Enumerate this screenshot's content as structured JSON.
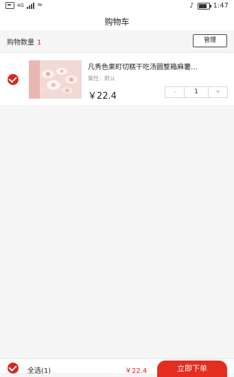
{
  "status_bar": {
    "time": "1:47",
    "network": "4G",
    "battery_level": 0.8
  },
  "nav": {
    "title": "购物车"
  },
  "cart_count": {
    "label": "购物数量",
    "value": "1",
    "manage_label": "管理"
  },
  "items": [
    {
      "title": "凡秀色果町切糕干吃汤圆整箱麻薯…",
      "attribute": "属性：默认",
      "price": "￥22.4",
      "quantity": "1",
      "minus_label": "-",
      "plus_label": "+",
      "checked": true
    }
  ],
  "footer": {
    "select_all_label": "全选(1)",
    "total": "￥22.4",
    "order_label": "立即下单"
  },
  "colors": {
    "accent": "#e0251b",
    "check": "#d9271d",
    "background": "#f5f5f5"
  }
}
